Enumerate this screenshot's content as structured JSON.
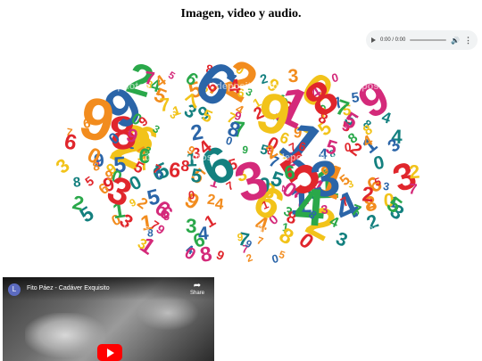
{
  "page": {
    "title": "Imagen, video y audio."
  },
  "audio": {
    "time": "0:00 / 0:00",
    "play_icon": "play-icon",
    "volume_icon": "volume-icon",
    "menu_icon": "more-vert-icon"
  },
  "image": {
    "watermark": "depositphotos",
    "digits": "7589120643"
  },
  "video": {
    "channel_initial": "L",
    "title": "Fito Páez - Cadáver Exquisito",
    "share_label": "Share",
    "play_icon": "youtube-play-icon"
  },
  "colors": {
    "red": "#e0262c",
    "orange": "#f28c1e",
    "yellow": "#f2c31a",
    "green": "#2aa84a",
    "teal": "#14807f",
    "blue": "#2b65a8",
    "magenta": "#d42a7a",
    "youtube_red": "#ff0000"
  }
}
